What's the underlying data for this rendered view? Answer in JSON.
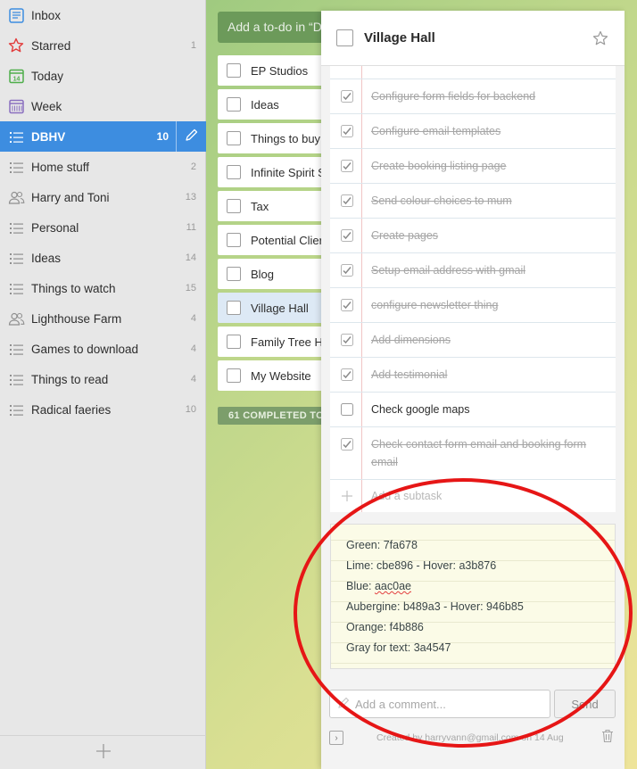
{
  "sidebar": {
    "items": [
      {
        "label": "Inbox",
        "count": "",
        "icon": "inbox-icon"
      },
      {
        "label": "Starred",
        "count": "1",
        "icon": "star-icon"
      },
      {
        "label": "Today",
        "count": "",
        "icon": "calendar-today-icon",
        "day": "14"
      },
      {
        "label": "Week",
        "count": "",
        "icon": "calendar-week-icon"
      },
      {
        "label": "DBHV",
        "count": "10",
        "icon": "list-icon"
      },
      {
        "label": "Home stuff",
        "count": "2",
        "icon": "list-icon"
      },
      {
        "label": "Harry and Toni",
        "count": "13",
        "icon": "shared-list-icon"
      },
      {
        "label": "Personal",
        "count": "11",
        "icon": "list-icon"
      },
      {
        "label": "Ideas",
        "count": "14",
        "icon": "list-icon"
      },
      {
        "label": "Things to watch",
        "count": "15",
        "icon": "list-icon"
      },
      {
        "label": "Lighthouse Farm",
        "count": "4",
        "icon": "shared-list-icon"
      },
      {
        "label": "Games to download",
        "count": "4",
        "icon": "list-icon"
      },
      {
        "label": "Things to read",
        "count": "4",
        "icon": "list-icon"
      },
      {
        "label": "Radical faeries",
        "count": "10",
        "icon": "list-icon"
      }
    ],
    "active_index": 4,
    "add_list_label": "+"
  },
  "list": {
    "add_placeholder": "Add a to-do in “D",
    "todos": [
      {
        "title": "EP Studios"
      },
      {
        "title": "Ideas"
      },
      {
        "title": "Things to buy"
      },
      {
        "title": "Infinite Spirit S"
      },
      {
        "title": "Tax"
      },
      {
        "title": "Potential Clier"
      },
      {
        "title": "Blog"
      },
      {
        "title": "Village Hall"
      },
      {
        "title": "Family Tree He"
      },
      {
        "title": "My Website"
      }
    ],
    "selected_index": 7,
    "completed_label": "61 COMPLETED TO"
  },
  "detail": {
    "title": "Village Hall",
    "subtasks": [
      {
        "title": "Configure form fields for backend",
        "done": true
      },
      {
        "title": "Configure email templates",
        "done": true
      },
      {
        "title": "Create booking listing page",
        "done": true
      },
      {
        "title": "Send colour choices to mum",
        "done": true
      },
      {
        "title": "Create pages",
        "done": true
      },
      {
        "title": "Setup email address with gmail",
        "done": true
      },
      {
        "title": "configure newsletter thing",
        "done": true
      },
      {
        "title": "Add dimensions",
        "done": true
      },
      {
        "title": "Add testimonial",
        "done": true
      },
      {
        "title": "Check google maps",
        "done": false
      },
      {
        "title": "Check contact form email and booking form email",
        "done": true
      }
    ],
    "add_subtask_placeholder": "Add a subtask",
    "note": {
      "lines": [
        {
          "prefix": "Green: ",
          "value": "7fa678",
          "suffix": ""
        },
        {
          "prefix": "Lime: ",
          "value": "cbe896",
          "suffix": " - Hover: a3b876"
        },
        {
          "prefix": "Blue: ",
          "value": "aac0ae",
          "suffix": ""
        },
        {
          "prefix": "Aubergine: ",
          "value": "b489a3",
          "suffix": " - Hover: 946b85"
        },
        {
          "prefix": "Orange: ",
          "value": "f4b886",
          "suffix": ""
        },
        {
          "prefix": "Gray for text: ",
          "value": "3a4547",
          "suffix": ""
        }
      ]
    },
    "comment_placeholder": "Add a comment...",
    "send_label": "Send",
    "created_meta": "Created by harryvann@gmail.com on 14 Aug"
  },
  "colors": {
    "accent": "#3d8de0",
    "annotation": "#e61616",
    "star": "#e23b3b"
  }
}
